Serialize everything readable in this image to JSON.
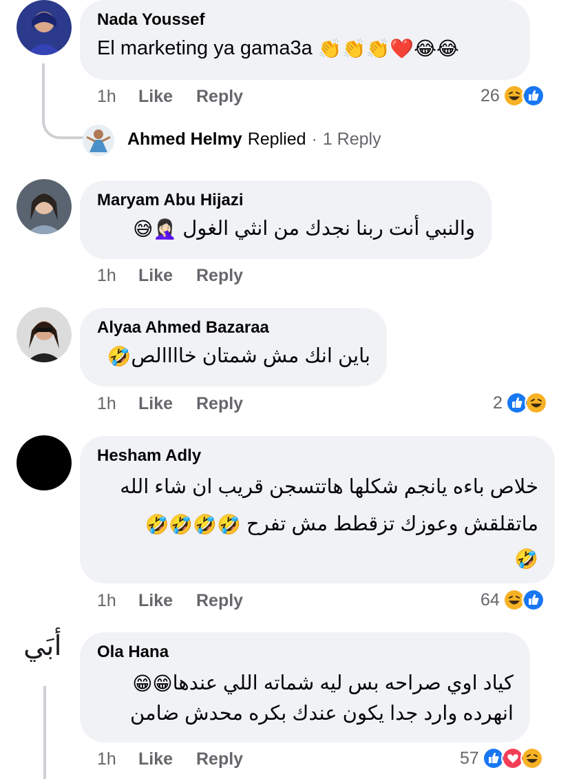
{
  "comments": [
    {
      "name": "Nada Youssef",
      "text": "El marketing ya gama3a",
      "emojis": "👏👏👏❤️😂😂",
      "time": "1h",
      "like": "Like",
      "reply": "Reply",
      "reaction_count": "26",
      "reactions": [
        "haha",
        "like"
      ]
    },
    {
      "name": "Maryam Abu Hijazi",
      "text": "والنبي أنت ربنا نجدك من انثي الغول",
      "emojis": "🤦🏻‍♀️😅",
      "time": "1h",
      "like": "Like",
      "reply": "Reply"
    },
    {
      "name": "Alyaa Ahmed Bazaraa",
      "text": "باين انك مش شمتان خاااالص",
      "emojis": "🤣",
      "time": "1h",
      "like": "Like",
      "reply": "Reply",
      "reaction_count": "2",
      "reactions": [
        "like",
        "haha"
      ]
    },
    {
      "name": "Hesham Adly",
      "line1": "خلاص باءه يانجم شكلها  هاتتسجن قريب ان شاء الله",
      "line2": "ماتقلقش وعوزك تزقطط مش تفرح",
      "emojis_line2": "🤣🤣🤣🤣",
      "emojis_line3": "🤣",
      "time": "1h",
      "like": "Like",
      "reply": "Reply",
      "reaction_count": "64",
      "reactions": [
        "haha",
        "like"
      ]
    },
    {
      "name": "Ola Hana",
      "line1": "كياد اوي صراحه بس ليه شماته اللي عندها",
      "emojis_line1": "😁😁",
      "line2": "انهرده وارد جدا يكون عندك بكره محدش ضامن",
      "time": "1h",
      "like": "Like",
      "reply": "Reply",
      "reaction_count": "57",
      "reactions": [
        "like",
        "love",
        "haha"
      ]
    }
  ],
  "reply_summary": {
    "name": "Ahmed Helmy",
    "verb": "Replied",
    "separator": "·",
    "count": "1 Reply"
  },
  "page_logo": "أبَي",
  "colors": {
    "bubble": "#f0f2f5",
    "secondary_text": "#65676b",
    "like_blue": "#1877f2",
    "love_red": "#f33e58",
    "haha_yellow": "#f7b125"
  }
}
